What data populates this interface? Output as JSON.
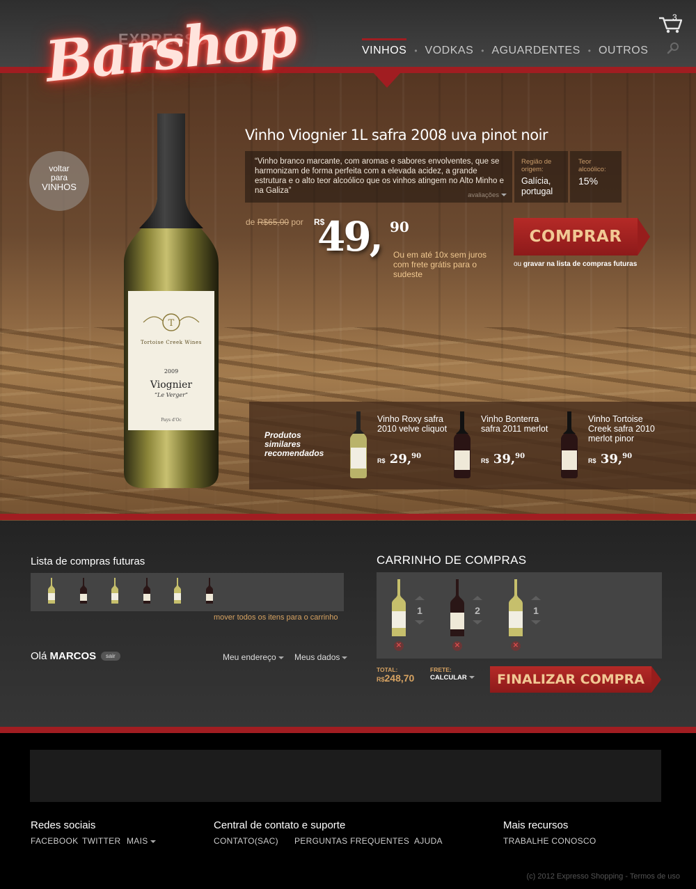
{
  "brand": {
    "small": "EXPRESSO",
    "script": "Barshop"
  },
  "nav": {
    "items": [
      {
        "label": "VINHOS",
        "active": true
      },
      {
        "label": "VODKAS"
      },
      {
        "label": "AGUARDENTES"
      },
      {
        "label": "OUTROS"
      }
    ],
    "separator": "•"
  },
  "cart_icon": {
    "count": "3",
    "icon": "cart-icon"
  },
  "search": {
    "icon": "search-icon"
  },
  "back": {
    "line1": "voltar",
    "line2": "para",
    "line3": "VINHOS"
  },
  "product": {
    "title": "Vinho Viognier 1L safra 2008 uva pinot noir",
    "description": "“Vinho branco marcante, com aromas e sabores envolventes, que se harmonizam de forma perfeita com a elevada acidez, a grande estrutura e o alto teor alcoólico que os vinhos atingem no Alto Minho e na Galiza”",
    "reviews_label": "avaliações",
    "region_label": "Região de origem:",
    "region_value": "Galícia, portugal",
    "alcohol_label": "Teor alcoólico:",
    "alcohol_value": "15%",
    "old_price_prefix": "de",
    "old_price": "R$65,00",
    "old_price_suffix": "por",
    "currency": "R$",
    "price_int": "49,",
    "price_dec": "90",
    "installments": "Ou em até 10x sem juros com frete grátis para o sudeste",
    "buy_label": "COMPRAR",
    "wishlist_prefix": "ou",
    "wishlist_link": "gravar na lista de compras futuras",
    "bottle_label": {
      "brand": "Tortoise Creek Wines",
      "year": "2009",
      "name": "Viognier",
      "sub": "“Le Verger”",
      "origin": "Pays d'Oc"
    }
  },
  "similar": {
    "label": "Produtos similares recomendados",
    "items": [
      {
        "name": "Vinho Roxy safra 2010 velve cliquot",
        "currency": "R$",
        "price_int": "29,",
        "price_dec": "90",
        "wine": "white"
      },
      {
        "name": "Vinho Bonterra safra 2011 merlot",
        "currency": "R$",
        "price_int": "39,",
        "price_dec": "90",
        "wine": "red"
      },
      {
        "name": "Vinho Tortoise Creek safra 2010 merlot pinor",
        "currency": "R$",
        "price_int": "39,",
        "price_dec": "90",
        "wine": "red"
      }
    ]
  },
  "wishlist": {
    "title": "Lista de compras futuras",
    "bottles": [
      "white",
      "red",
      "white",
      "red",
      "white",
      "red"
    ],
    "move_all": "mover todos os itens para o carrinho"
  },
  "user": {
    "greeting": "Olá",
    "name": "MARCOS",
    "logout": "sair",
    "address_link": "Meu endereço",
    "data_link": "Meus dados"
  },
  "cart": {
    "title": "CARRINHO DE COMPRAS",
    "items": [
      {
        "qty": "1",
        "wine": "white"
      },
      {
        "qty": "2",
        "wine": "red"
      },
      {
        "qty": "1",
        "wine": "white"
      }
    ],
    "total_label": "TOTAL:",
    "total_currency": "R$",
    "total_value": "248,70",
    "freight_label": "FRETE:",
    "freight_value": "CALCULAR",
    "finish_label": "FINALIZAR COMPRA"
  },
  "footer": {
    "social": {
      "title": "Redes sociais",
      "links": [
        "FACEBOOK",
        "TWITTER",
        "MAIS"
      ]
    },
    "contact": {
      "title": "Central de contato e suporte",
      "links": [
        "CONTATO(SAC)",
        "PERGUNTAS FREQUENTES",
        "AJUDA"
      ]
    },
    "more": {
      "title": "Mais recursos",
      "links": [
        "TRABALHE CONOSCO"
      ]
    },
    "copyright": "(c) 2012 Expresso Shopping - Termos de uso"
  },
  "colors": {
    "brand_red": "#a11d21",
    "accent_gold": "#d7a362",
    "button_text": "#f1c894"
  }
}
